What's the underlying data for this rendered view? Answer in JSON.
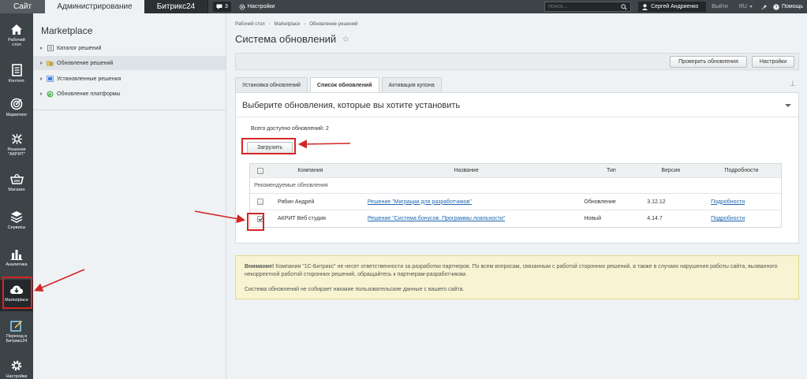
{
  "topbar": {
    "site_label": "Сайт",
    "admin_label": "Администрирование",
    "b24_label": "Битрикс24",
    "badge_count": "3",
    "settings_label": "Настройки",
    "search_placeholder": "поиск...",
    "user_name": "Сергей Андриенко",
    "logout_label": "Выйти",
    "lang_label": "RU",
    "help_label": "Помощь"
  },
  "leftbar": {
    "items": [
      {
        "label": "Рабочий стол",
        "icon": "home-icon"
      },
      {
        "label": "Контент",
        "icon": "document-icon"
      },
      {
        "label": "Маркетинг",
        "icon": "target-icon"
      },
      {
        "label": "Решения \"АКРИТ\"",
        "icon": "pattern-icon"
      },
      {
        "label": "Магазин",
        "icon": "cart-icon"
      },
      {
        "label": "Сервисы",
        "icon": "layers-icon"
      },
      {
        "label": "Аналитика",
        "icon": "bar-chart-icon"
      },
      {
        "label": "Marketplace",
        "icon": "cloud-download-icon"
      },
      {
        "label": "Переход в Битрикс24",
        "icon": "pencil-box-icon"
      },
      {
        "label": "Настройки",
        "icon": "gear-icon"
      }
    ]
  },
  "sidebar": {
    "title": "Marketplace",
    "items": [
      {
        "label": "Каталог решений"
      },
      {
        "label": "Обновление решений"
      },
      {
        "label": "Установленные решения"
      },
      {
        "label": "Обновление платформы"
      }
    ]
  },
  "breadcrumb": {
    "items": [
      "Рабочий стол",
      "Marketplace",
      "Обновление решений"
    ],
    "separator": "›"
  },
  "page": {
    "title": "Система обновлений",
    "check_updates_label": "Проверить обновления",
    "settings_label": "Настройки"
  },
  "tabs": [
    {
      "label": "Установка обновлений"
    },
    {
      "label": "Список обновлений"
    },
    {
      "label": "Активация купона"
    }
  ],
  "panel": {
    "heading": "Выберите обновления, которые вы хотите установить",
    "available_text": "Всего доступно обновлений: 2",
    "load_label": "Загрузить"
  },
  "table": {
    "headers": {
      "company": "Компания",
      "name": "Название",
      "type": "Тип",
      "version": "Версия",
      "details": "Подробности"
    },
    "group_label": "Рекомендуемые обновления",
    "rows": [
      {
        "checked": false,
        "company": "Рябин Андрей",
        "name": "Решение \"Миграции для разработчиков\"",
        "type": "Обновление",
        "version": "3.12.12",
        "details": "Подробности"
      },
      {
        "checked": true,
        "company": "АКРИТ Веб студия",
        "name": "Решение \"Система бонусов. Программы лояльности\"",
        "type": "Новый",
        "version": "4.14.7",
        "details": "Подробности"
      }
    ]
  },
  "notice": {
    "warning_bold": "Внимание!",
    "warning_text": "Компания \"1С-Битрикс\" не несет ответственности за разработки партнеров. По всем вопросам, связанным с работой сторонних решений, а также в случаях нарушения работы сайта, вызванного некорректной работой сторонних решений, обращайтесь к партнерам-разработчикам.",
    "privacy_text": "Система обновлений не собирает никакие пользовательские данные с вашего сайта."
  },
  "colors": {
    "topbar_bg": "#3d4448",
    "annotation_red": "#d42626",
    "link_blue": "#2067b0",
    "notice_bg": "#f8f4d2"
  }
}
